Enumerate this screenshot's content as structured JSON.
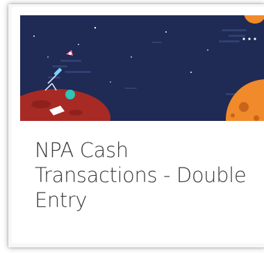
{
  "card": {
    "title": "NPA Cash\nTransactions - Double\nEntry",
    "banner": {
      "illustration": "space-scene",
      "background_color": "#1f2a55",
      "planet_color": "#a82a24",
      "moon_color": "#f08a2a"
    }
  }
}
